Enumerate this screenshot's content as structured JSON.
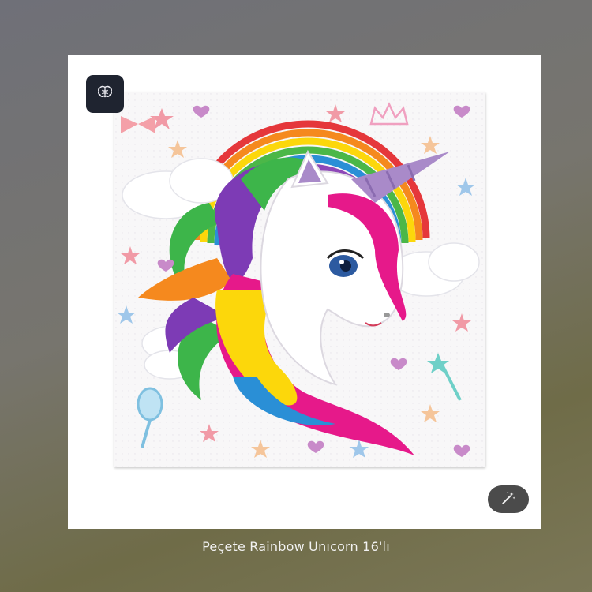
{
  "product": {
    "caption": "Peçete Rainbow Unıcorn 16'lı",
    "image_icon": "unicorn-rainbow-napkin-image"
  },
  "badges": {
    "ai_icon": "brain-icon",
    "edit_icon": "magic-wand-icon"
  },
  "colors": {
    "badge_bg": "#1f2430",
    "pill_bg": "#4b4b4b",
    "card_bg": "#ffffff"
  }
}
